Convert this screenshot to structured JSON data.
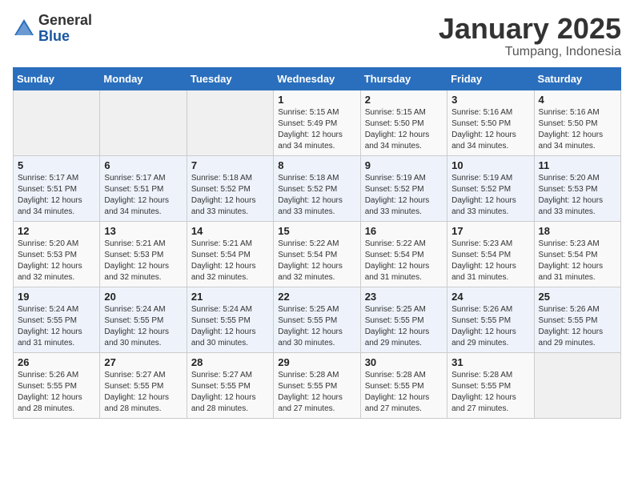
{
  "logo": {
    "general": "General",
    "blue": "Blue"
  },
  "title": "January 2025",
  "location": "Tumpang, Indonesia",
  "weekdays": [
    "Sunday",
    "Monday",
    "Tuesday",
    "Wednesday",
    "Thursday",
    "Friday",
    "Saturday"
  ],
  "weeks": [
    [
      {
        "day": "",
        "info": ""
      },
      {
        "day": "",
        "info": ""
      },
      {
        "day": "",
        "info": ""
      },
      {
        "day": "1",
        "info": "Sunrise: 5:15 AM\nSunset: 5:49 PM\nDaylight: 12 hours\nand 34 minutes."
      },
      {
        "day": "2",
        "info": "Sunrise: 5:15 AM\nSunset: 5:50 PM\nDaylight: 12 hours\nand 34 minutes."
      },
      {
        "day": "3",
        "info": "Sunrise: 5:16 AM\nSunset: 5:50 PM\nDaylight: 12 hours\nand 34 minutes."
      },
      {
        "day": "4",
        "info": "Sunrise: 5:16 AM\nSunset: 5:50 PM\nDaylight: 12 hours\nand 34 minutes."
      }
    ],
    [
      {
        "day": "5",
        "info": "Sunrise: 5:17 AM\nSunset: 5:51 PM\nDaylight: 12 hours\nand 34 minutes."
      },
      {
        "day": "6",
        "info": "Sunrise: 5:17 AM\nSunset: 5:51 PM\nDaylight: 12 hours\nand 34 minutes."
      },
      {
        "day": "7",
        "info": "Sunrise: 5:18 AM\nSunset: 5:52 PM\nDaylight: 12 hours\nand 33 minutes."
      },
      {
        "day": "8",
        "info": "Sunrise: 5:18 AM\nSunset: 5:52 PM\nDaylight: 12 hours\nand 33 minutes."
      },
      {
        "day": "9",
        "info": "Sunrise: 5:19 AM\nSunset: 5:52 PM\nDaylight: 12 hours\nand 33 minutes."
      },
      {
        "day": "10",
        "info": "Sunrise: 5:19 AM\nSunset: 5:52 PM\nDaylight: 12 hours\nand 33 minutes."
      },
      {
        "day": "11",
        "info": "Sunrise: 5:20 AM\nSunset: 5:53 PM\nDaylight: 12 hours\nand 33 minutes."
      }
    ],
    [
      {
        "day": "12",
        "info": "Sunrise: 5:20 AM\nSunset: 5:53 PM\nDaylight: 12 hours\nand 32 minutes."
      },
      {
        "day": "13",
        "info": "Sunrise: 5:21 AM\nSunset: 5:53 PM\nDaylight: 12 hours\nand 32 minutes."
      },
      {
        "day": "14",
        "info": "Sunrise: 5:21 AM\nSunset: 5:54 PM\nDaylight: 12 hours\nand 32 minutes."
      },
      {
        "day": "15",
        "info": "Sunrise: 5:22 AM\nSunset: 5:54 PM\nDaylight: 12 hours\nand 32 minutes."
      },
      {
        "day": "16",
        "info": "Sunrise: 5:22 AM\nSunset: 5:54 PM\nDaylight: 12 hours\nand 31 minutes."
      },
      {
        "day": "17",
        "info": "Sunrise: 5:23 AM\nSunset: 5:54 PM\nDaylight: 12 hours\nand 31 minutes."
      },
      {
        "day": "18",
        "info": "Sunrise: 5:23 AM\nSunset: 5:54 PM\nDaylight: 12 hours\nand 31 minutes."
      }
    ],
    [
      {
        "day": "19",
        "info": "Sunrise: 5:24 AM\nSunset: 5:55 PM\nDaylight: 12 hours\nand 31 minutes."
      },
      {
        "day": "20",
        "info": "Sunrise: 5:24 AM\nSunset: 5:55 PM\nDaylight: 12 hours\nand 30 minutes."
      },
      {
        "day": "21",
        "info": "Sunrise: 5:24 AM\nSunset: 5:55 PM\nDaylight: 12 hours\nand 30 minutes."
      },
      {
        "day": "22",
        "info": "Sunrise: 5:25 AM\nSunset: 5:55 PM\nDaylight: 12 hours\nand 30 minutes."
      },
      {
        "day": "23",
        "info": "Sunrise: 5:25 AM\nSunset: 5:55 PM\nDaylight: 12 hours\nand 29 minutes."
      },
      {
        "day": "24",
        "info": "Sunrise: 5:26 AM\nSunset: 5:55 PM\nDaylight: 12 hours\nand 29 minutes."
      },
      {
        "day": "25",
        "info": "Sunrise: 5:26 AM\nSunset: 5:55 PM\nDaylight: 12 hours\nand 29 minutes."
      }
    ],
    [
      {
        "day": "26",
        "info": "Sunrise: 5:26 AM\nSunset: 5:55 PM\nDaylight: 12 hours\nand 28 minutes."
      },
      {
        "day": "27",
        "info": "Sunrise: 5:27 AM\nSunset: 5:55 PM\nDaylight: 12 hours\nand 28 minutes."
      },
      {
        "day": "28",
        "info": "Sunrise: 5:27 AM\nSunset: 5:55 PM\nDaylight: 12 hours\nand 28 minutes."
      },
      {
        "day": "29",
        "info": "Sunrise: 5:28 AM\nSunset: 5:55 PM\nDaylight: 12 hours\nand 27 minutes."
      },
      {
        "day": "30",
        "info": "Sunrise: 5:28 AM\nSunset: 5:55 PM\nDaylight: 12 hours\nand 27 minutes."
      },
      {
        "day": "31",
        "info": "Sunrise: 5:28 AM\nSunset: 5:55 PM\nDaylight: 12 hours\nand 27 minutes."
      },
      {
        "day": "",
        "info": ""
      }
    ]
  ]
}
